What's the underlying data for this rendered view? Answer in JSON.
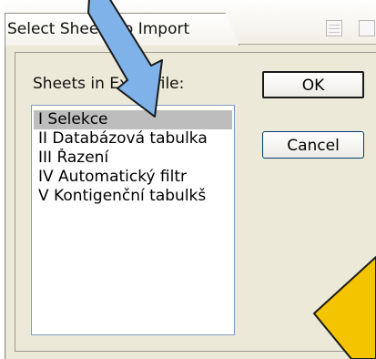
{
  "dialog": {
    "title": "Select Sheets to Import",
    "sheets_label": "Sheets in Excel file:",
    "ok_label": "OK",
    "cancel_label": "Cancel"
  },
  "sheets": [
    {
      "label": "I Selekce",
      "selected": true
    },
    {
      "label": "II Databázová tabulka",
      "selected": false
    },
    {
      "label": "III Řazení",
      "selected": false
    },
    {
      "label": "IV Automatický filtr",
      "selected": false
    },
    {
      "label": "V Kontigenční tabulkš",
      "selected": false
    }
  ],
  "annotations": {
    "arrow_color": "#7fb2e8",
    "arrow_outline": "#1a1a1a",
    "pointer_color": "#f5c400"
  },
  "icons": [
    "window-tile-icon",
    "window-restore-icon"
  ]
}
